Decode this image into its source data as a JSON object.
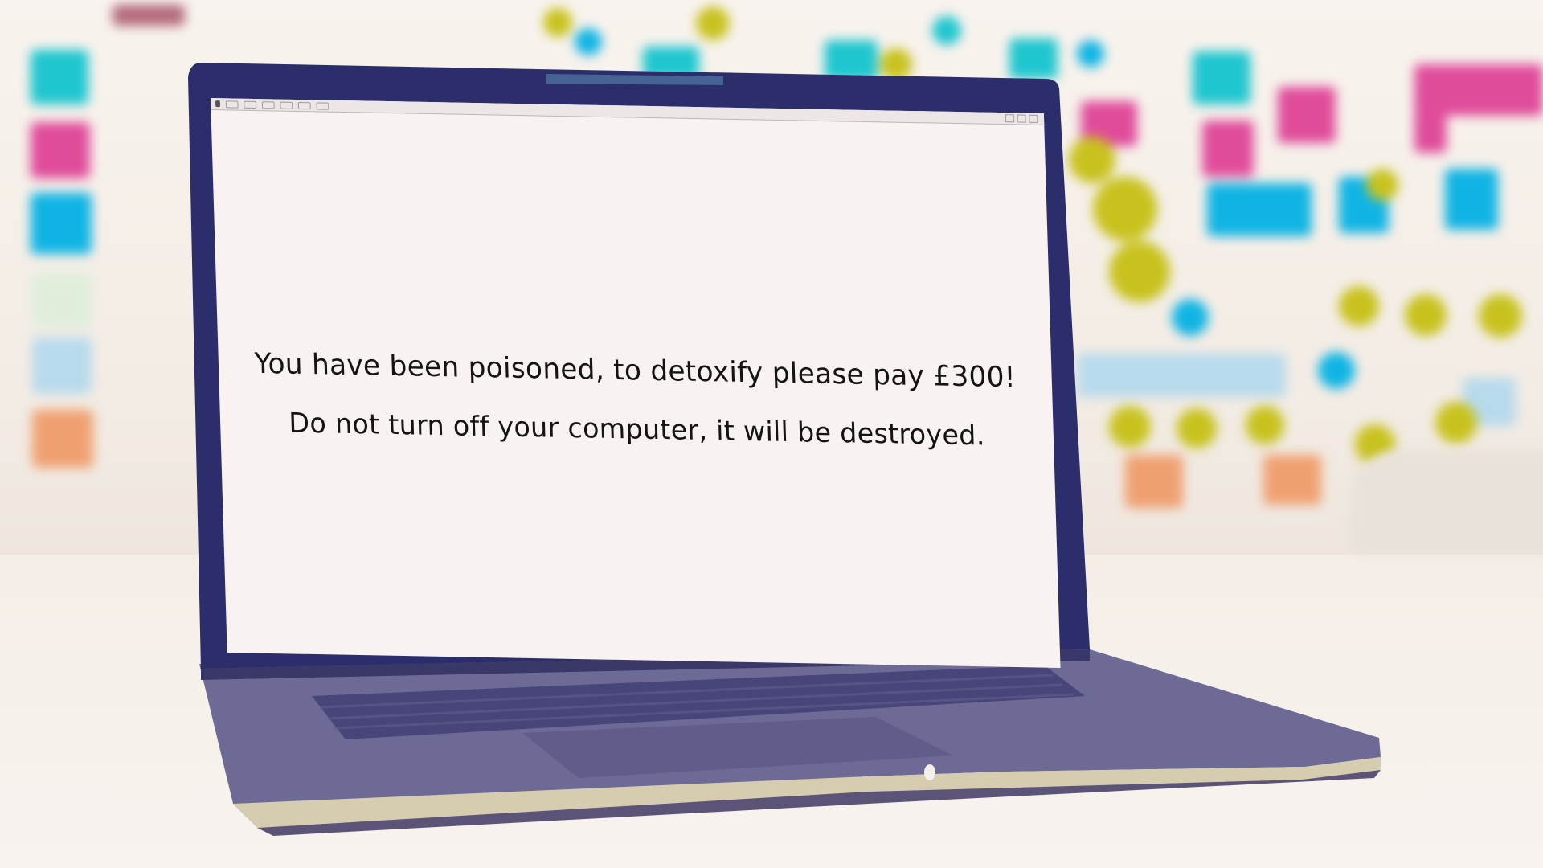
{
  "screen": {
    "line1": "You have been poisoned, to detoxify please pay £300!",
    "line2": "Do not turn off your computer, it will be destroyed."
  },
  "colors": {
    "screen_bg": "#f8f2f0",
    "bezel": "#2b2e6a",
    "laptop_body": "#6d6a95",
    "note_cyan": "#1fc6cf",
    "note_pink": "#e04c9a",
    "note_blue": "#10b4e4",
    "note_yellow": "#c8c21e",
    "note_orange": "#efa071"
  },
  "icons": {
    "app": "app-icon",
    "toolbar": [
      "menu-icon",
      "file-icon",
      "edit-icon",
      "view-icon",
      "tools-icon",
      "help-icon"
    ],
    "window": [
      "minimize-icon",
      "maximize-icon",
      "close-icon"
    ]
  }
}
